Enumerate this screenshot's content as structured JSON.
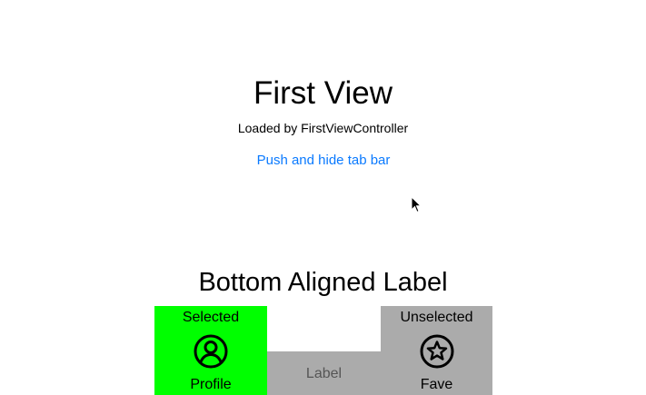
{
  "main": {
    "title": "First View",
    "subtitle": "Loaded by FirstViewController",
    "push_link": "Push and hide tab bar",
    "bottom_label": "Bottom Aligned Label"
  },
  "tabbar": {
    "tabs": [
      {
        "status": "Selected",
        "icon": "profile-icon",
        "label": "Profile",
        "background": "#00ff00"
      },
      {
        "label": "Label",
        "background": "#ababab"
      },
      {
        "status": "Unselected",
        "icon": "star-icon",
        "label": "Fave",
        "background": "#ababab"
      }
    ]
  },
  "colors": {
    "link": "#0a7aff",
    "selected_tab": "#00ff00",
    "unselected_tab": "#ababab",
    "middle_label": "#555555"
  }
}
